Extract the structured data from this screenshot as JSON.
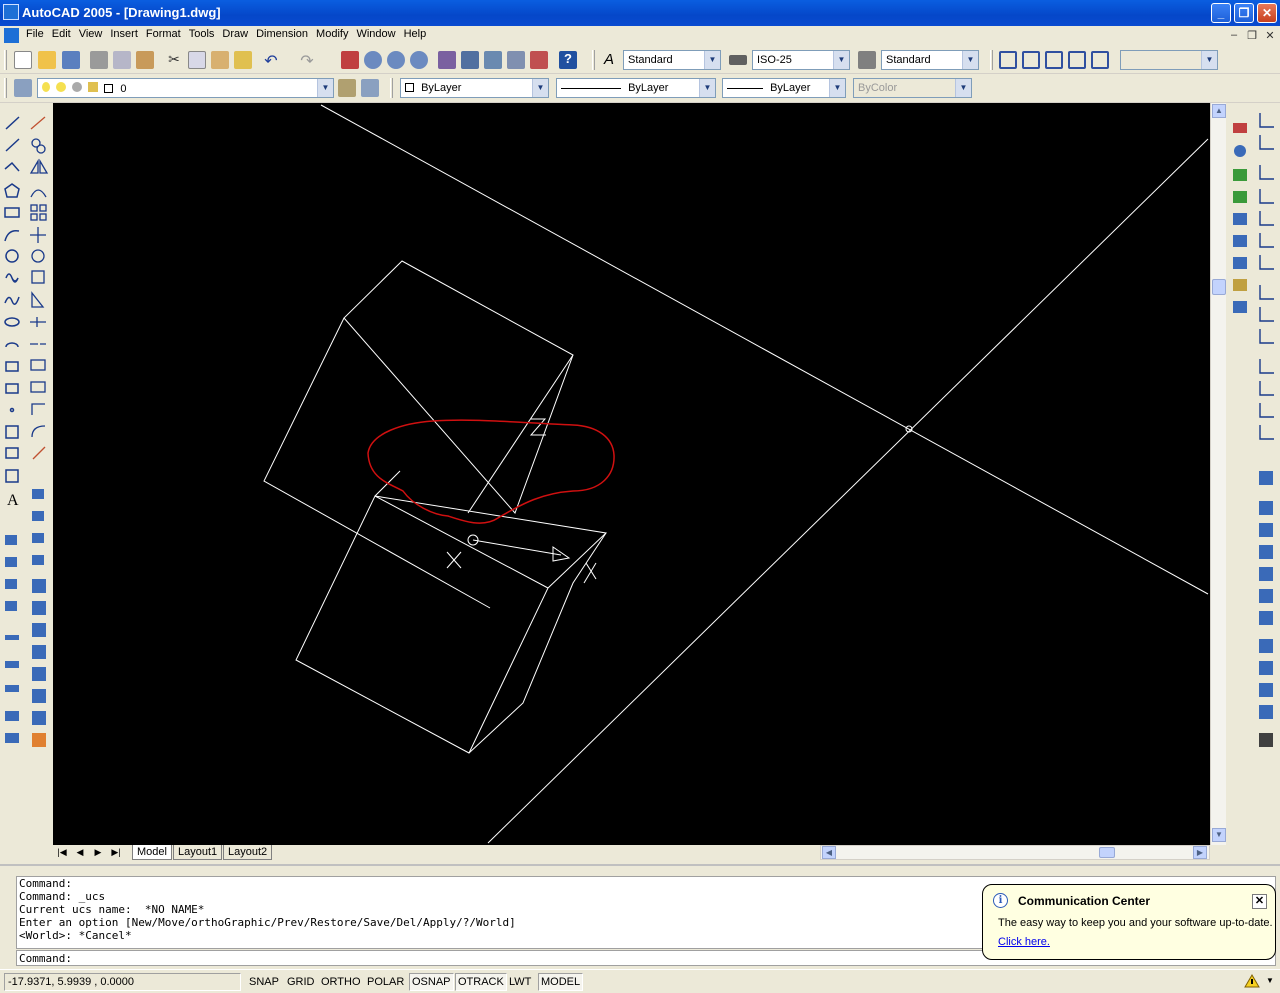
{
  "window": {
    "title": "AutoCAD 2005 - [Drawing1.dwg]"
  },
  "menu": [
    "File",
    "Edit",
    "View",
    "Insert",
    "Format",
    "Tools",
    "Draw",
    "Dimension",
    "Modify",
    "Window",
    "Help"
  ],
  "toolbar_std": {
    "text_style": "Standard",
    "dim_style": "ISO-25",
    "table_style": "Standard"
  },
  "toolbar_props": {
    "layer": "0",
    "color": "ByLayer",
    "linetype": "ByLayer",
    "lineweight": "ByLayer",
    "plot_style": "ByColor"
  },
  "layout_tabs": {
    "model": "Model",
    "layout1": "Layout1",
    "layout2": "Layout2"
  },
  "command": {
    "history": [
      "Command:",
      "Command: _ucs",
      "Current ucs name:  *NO NAME*",
      "Enter an option [New/Move/orthoGraphic/Prev/Restore/Save/Del/Apply/?/World]",
      "<World>: *Cancel*"
    ],
    "prompt": "Command:"
  },
  "comm_center": {
    "title": "Communication Center",
    "message": "The easy way to keep you and your software up-to-date.",
    "link": "Click here."
  },
  "status": {
    "coords": "-17.9371, 5.9939 , 0.0000",
    "snap": "SNAP",
    "grid": "GRID",
    "ortho": "ORTHO",
    "polar": "POLAR",
    "osnap": "OSNAP",
    "otrack": "OTRACK",
    "lwt": "LWT",
    "model": "MODEL"
  },
  "colors": {
    "canvas": "#000000",
    "geometry": "#ffffff",
    "revcloud": "#d01010",
    "title_bar": "#0547c9"
  }
}
